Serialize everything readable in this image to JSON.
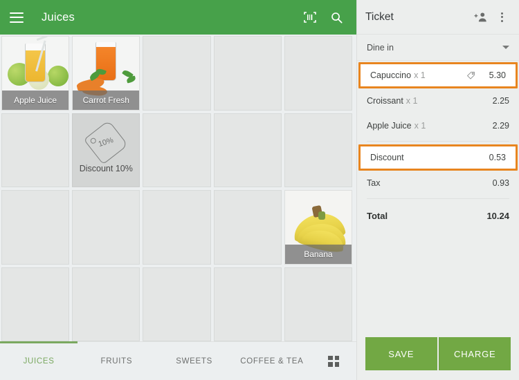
{
  "appbar": {
    "title": "Juices",
    "menu_icon": "hamburger-menu-icon",
    "scan_icon": "barcode-scanner-icon",
    "search_icon": "search-icon",
    "color": "#47a14a"
  },
  "catalog": {
    "columns": 5,
    "rows": 4,
    "tiles": [
      {
        "index": 0,
        "type": "product",
        "label": "Apple Juice",
        "art": "apple-juice"
      },
      {
        "index": 1,
        "type": "product",
        "label": "Carrot Fresh",
        "art": "carrot-fresh"
      },
      {
        "index": 2,
        "type": "empty",
        "label": ""
      },
      {
        "index": 3,
        "type": "empty",
        "label": ""
      },
      {
        "index": 4,
        "type": "empty",
        "label": ""
      },
      {
        "index": 5,
        "type": "empty",
        "label": ""
      },
      {
        "index": 6,
        "type": "action",
        "label": "Discount 10%",
        "art": "tag-percent",
        "percent": "10%"
      },
      {
        "index": 7,
        "type": "empty",
        "label": ""
      },
      {
        "index": 8,
        "type": "empty",
        "label": ""
      },
      {
        "index": 9,
        "type": "empty",
        "label": ""
      },
      {
        "index": 10,
        "type": "empty",
        "label": ""
      },
      {
        "index": 11,
        "type": "empty",
        "label": ""
      },
      {
        "index": 12,
        "type": "empty",
        "label": ""
      },
      {
        "index": 13,
        "type": "empty",
        "label": ""
      },
      {
        "index": 14,
        "type": "product",
        "label": "Banana",
        "art": "banana"
      },
      {
        "index": 15,
        "type": "empty",
        "label": ""
      },
      {
        "index": 16,
        "type": "empty",
        "label": ""
      },
      {
        "index": 17,
        "type": "empty",
        "label": ""
      },
      {
        "index": 18,
        "type": "empty",
        "label": ""
      },
      {
        "index": 19,
        "type": "empty",
        "label": ""
      }
    ]
  },
  "tabs": {
    "items": [
      {
        "label": "JUICES",
        "active": true
      },
      {
        "label": "FRUITS",
        "active": false
      },
      {
        "label": "SWEETS",
        "active": false
      },
      {
        "label": "COFFEE & TEA",
        "active": false
      }
    ],
    "grid_icon": "grid-view-icon",
    "active_color": "#7aa860"
  },
  "ticket": {
    "title": "Ticket",
    "add_customer_icon": "add-person-icon",
    "overflow_icon": "more-vertical-icon",
    "dining_option": "Dine in",
    "highlight_color": "#e8851f",
    "line_items": [
      {
        "name": "Capuccino",
        "qty": "x 1",
        "amount": "5.30",
        "selected": true,
        "has_tag_icon": true
      },
      {
        "name": "Croissant",
        "qty": "x 1",
        "amount": "2.25",
        "selected": false,
        "has_tag_icon": false
      },
      {
        "name": "Apple Juice",
        "qty": "x 1",
        "amount": "2.29",
        "selected": false,
        "has_tag_icon": false
      }
    ],
    "adjustments": [
      {
        "label": "Discount",
        "amount": "0.53",
        "selected": true
      },
      {
        "label": "Tax",
        "amount": "0.93",
        "selected": false
      }
    ],
    "total_label": "Total",
    "total_amount": "10.24",
    "save_label": "SAVE",
    "charge_label": "CHARGE",
    "button_color": "#72a844"
  }
}
